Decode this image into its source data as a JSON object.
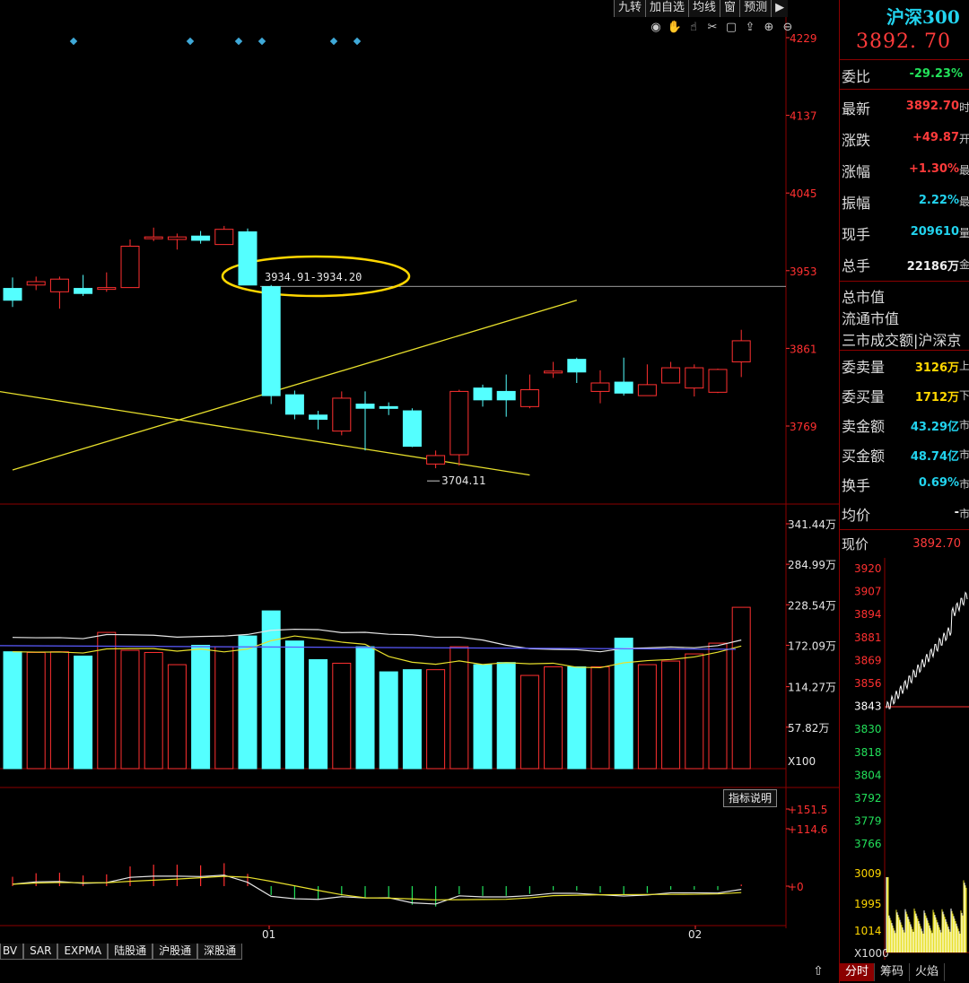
{
  "toolbar": [
    "九转",
    "加自选",
    "均线",
    "窗",
    "预测"
  ],
  "main": {
    "price_axis": [
      "4229",
      "4137",
      "4045",
      "3953",
      "3861",
      "3769"
    ],
    "annotation_range": "3934.91-3934.20",
    "low_label": "3704.11"
  },
  "volume": {
    "axis": [
      "341.44万",
      "284.99万",
      "228.54万",
      "172.09万",
      "114.27万",
      "57.82万"
    ],
    "unit": "X100"
  },
  "indicator": {
    "axis": [
      "+151.5",
      "+114.6",
      "+0"
    ],
    "explain": "指标说明"
  },
  "x_labels": [
    "01",
    "02"
  ],
  "bottom_tabs": [
    "BV",
    "SAR",
    "EXPMA",
    "陆股通",
    "沪股通",
    "深股通"
  ],
  "side": {
    "title": "沪深300",
    "price": "3892. 70",
    "weibi": {
      "label": "委比",
      "value": "-29.23%"
    },
    "rows": [
      {
        "label": "最新",
        "value": "3892.70",
        "cls": "red",
        "stub": "时"
      },
      {
        "label": "涨跌",
        "value": "+49.87",
        "cls": "red",
        "stub": "开"
      },
      {
        "label": "涨幅",
        "value": "+1.30%",
        "cls": "red",
        "stub": "最"
      },
      {
        "label": "振幅",
        "value": "2.22%",
        "cls": "cyan",
        "stub": "最"
      },
      {
        "label": "现手",
        "value": "209610",
        "cls": "cyan",
        "stub": "量"
      },
      {
        "label": "总手",
        "value": "22186万",
        "cls": "white",
        "stub": "金"
      }
    ],
    "labels2": [
      "总市值",
      "流通市值",
      "三市成交额|沪深京"
    ],
    "rows2": [
      {
        "label": "委卖量",
        "value": "3126万",
        "cls": "yellow",
        "stub": "上"
      },
      {
        "label": "委买量",
        "value": "1712万",
        "cls": "yellow",
        "stub": "下"
      },
      {
        "label": "卖金额",
        "value": "43.29亿",
        "cls": "cyan",
        "stub": "市"
      },
      {
        "label": "买金额",
        "value": "48.74亿",
        "cls": "cyan",
        "stub": "市"
      },
      {
        "label": "换手",
        "value": "0.69%",
        "cls": "cyan",
        "stub": "市"
      },
      {
        "label": "均价",
        "value": "-",
        "cls": "white",
        "stub": "市"
      }
    ],
    "now_label": "现价",
    "now_value": "3892.70",
    "mini_axis": [
      "3920",
      "3907",
      "3894",
      "3881",
      "3869",
      "3856",
      "3843",
      "3830",
      "3818",
      "3804",
      "3792",
      "3779",
      "3766"
    ],
    "mini_vol_axis": [
      "3009",
      "1995",
      "1014",
      "X1000"
    ],
    "mini_tabs": [
      "分时",
      "筹码",
      "火焰"
    ]
  },
  "chart_data": {
    "type": "candlestick",
    "price_range": [
      3700,
      4240
    ],
    "candles": [
      [
        3932,
        3918,
        3945,
        3910,
        "d"
      ],
      [
        3936,
        3940,
        3946,
        3930,
        "u"
      ],
      [
        3928,
        3943,
        3946,
        3908,
        "u"
      ],
      [
        3932,
        3926,
        3948,
        3923,
        "d"
      ],
      [
        3931,
        3933,
        3951,
        3928,
        "u"
      ],
      [
        3933,
        3982,
        3990,
        3933,
        "u"
      ],
      [
        3992,
        3993,
        4004,
        3988,
        "d"
      ],
      [
        3990,
        3993,
        3997,
        3978,
        "u"
      ],
      [
        3994,
        3989,
        4000,
        3985,
        "d"
      ],
      [
        3984,
        4002,
        4006,
        3984,
        "u"
      ],
      [
        3999,
        3936,
        4003,
        3936,
        "d"
      ],
      [
        3934,
        3805,
        3936,
        3795,
        "d"
      ],
      [
        3806,
        3783,
        3811,
        3777,
        "d"
      ],
      [
        3782,
        3777,
        3787,
        3765,
        "d"
      ],
      [
        3763,
        3802,
        3810,
        3758,
        "u"
      ],
      [
        3795,
        3790,
        3810,
        3740,
        "d"
      ],
      [
        3792,
        3792,
        3797,
        3782,
        "d"
      ],
      [
        3787,
        3745,
        3790,
        3744,
        "d"
      ],
      [
        3724,
        3734,
        3740,
        3719,
        "u"
      ],
      [
        3735,
        3810,
        3812,
        3722,
        "u"
      ],
      [
        3814,
        3800,
        3818,
        3792,
        "d"
      ],
      [
        3810,
        3800,
        3830,
        3780,
        "d"
      ],
      [
        3792,
        3812,
        3830,
        3790,
        "u"
      ],
      [
        3833,
        3834,
        3845,
        3826,
        "d"
      ],
      [
        3848,
        3833,
        3850,
        3820,
        "d"
      ],
      [
        3810,
        3820,
        3835,
        3796,
        "d"
      ],
      [
        3821,
        3808,
        3850,
        3805,
        "d"
      ],
      [
        3805,
        3818,
        3842,
        3805,
        "u"
      ],
      [
        3820,
        3838,
        3845,
        3820,
        "d"
      ],
      [
        3814,
        3838,
        3842,
        3804,
        "u"
      ],
      [
        3809,
        3836,
        3837,
        3808,
        "u"
      ],
      [
        3845,
        3870,
        3883,
        3827,
        "u"
      ]
    ],
    "volumes": [
      163,
      162,
      163,
      157,
      190,
      165,
      162,
      145,
      172,
      170,
      185,
      220,
      178,
      152,
      147,
      170,
      135,
      138,
      138,
      170,
      145,
      148,
      130,
      142,
      142,
      142,
      182,
      145,
      150,
      160,
      175,
      225
    ],
    "lines": [
      {
        "name": "upper-trend-line",
        "points": [
          [
            0,
            3717
          ],
          [
            24,
            3918
          ]
        ]
      },
      {
        "name": "lower-trend-line",
        "points": [
          [
            -12,
            3860
          ],
          [
            22,
            3711
          ]
        ]
      }
    ]
  }
}
